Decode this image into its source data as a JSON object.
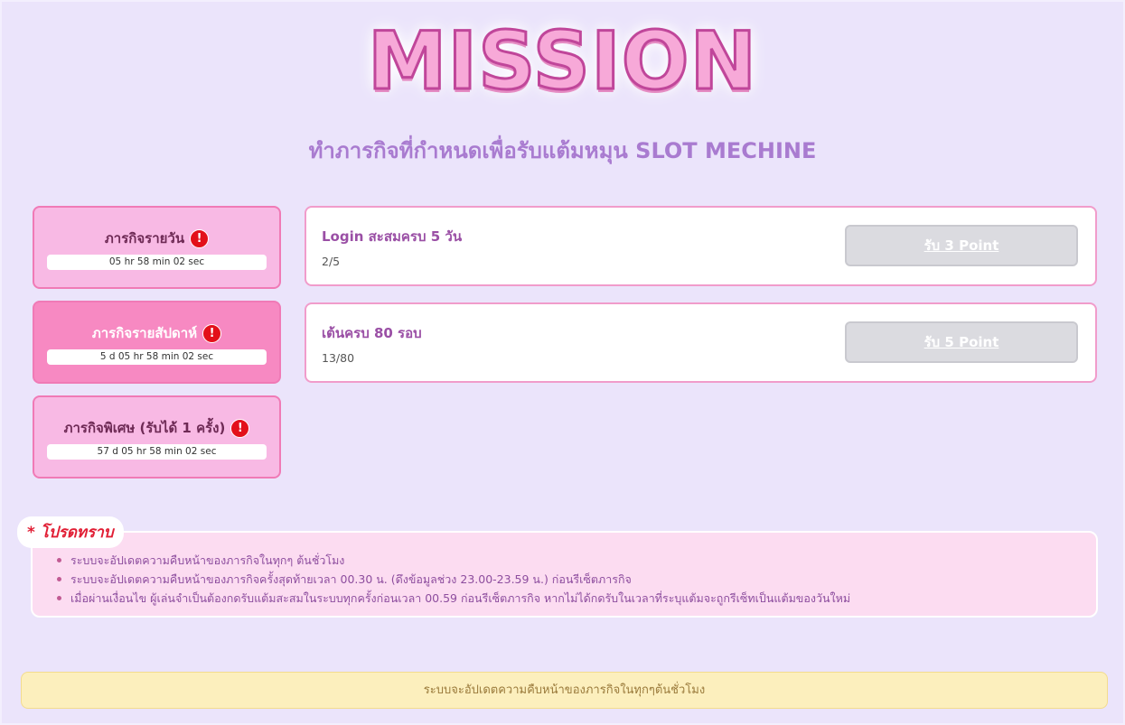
{
  "header": {
    "logo_text": "MISSION",
    "subtitle": "ทำภารกิจที่กำหนดเพื่อรับแต้มหมุน SLOT MECHINE"
  },
  "mission_tabs": [
    {
      "label": "ภารกิจรายวัน",
      "timer": "05 hr 58 min 02 sec",
      "icon": "alert-icon"
    },
    {
      "label": "ภารกิจรายสัปดาห์",
      "timer": "5 d 05 hr 58 min 02 sec",
      "icon": "alert-icon"
    },
    {
      "label": "ภารกิจพิเศษ (รับได้ 1 ครั้ง)",
      "timer": "57 d 05 hr 58 min 02 sec",
      "icon": "alert-icon"
    }
  ],
  "tasks": [
    {
      "title": "Login สะสมครบ 5 วัน",
      "progress": "2/5",
      "button_label": "รับ 3 Point"
    },
    {
      "title": "เต้นครบ 80 รอบ",
      "progress": "13/80",
      "button_label": "รับ 5 Point"
    }
  ],
  "notice": {
    "tag": "* โปรดทราบ",
    "items": [
      "ระบบจะอัปเดตความคืบหน้าของภารกิจในทุกๆ ต้นชั่วโมง",
      "ระบบจะอัปเดตความคืบหน้าของภารกิจครั้งสุดท้ายเวลา 00.30 น. (ดึงข้อมูลช่วง 23.00-23.59 น.) ก่อนรีเซ็ตภารกิจ",
      "เมื่อผ่านเงื่อนไข ผู้เล่นจำเป็นต้องกดรับแต้มสะสมในระบบทุกครั้งก่อนเวลา 00.59 ก่อนรีเซ็ตภารกิจ หากไม่ได้กดรับในเวลาที่ระบุแต้มจะถูกรีเซ็ทเป็นแต้มของวันใหม่"
    ]
  },
  "footer": {
    "message": "ระบบจะอัปเดตความคืบหน้าของภารกิจในทุกๆต้นชั่วโมง"
  },
  "colors": {
    "background": "#ebe4fb",
    "tab_pink": "#f8b9e4",
    "tab_active": "#f789c2",
    "alert_red": "#e3101a",
    "accent_purple": "#a97bd0"
  }
}
